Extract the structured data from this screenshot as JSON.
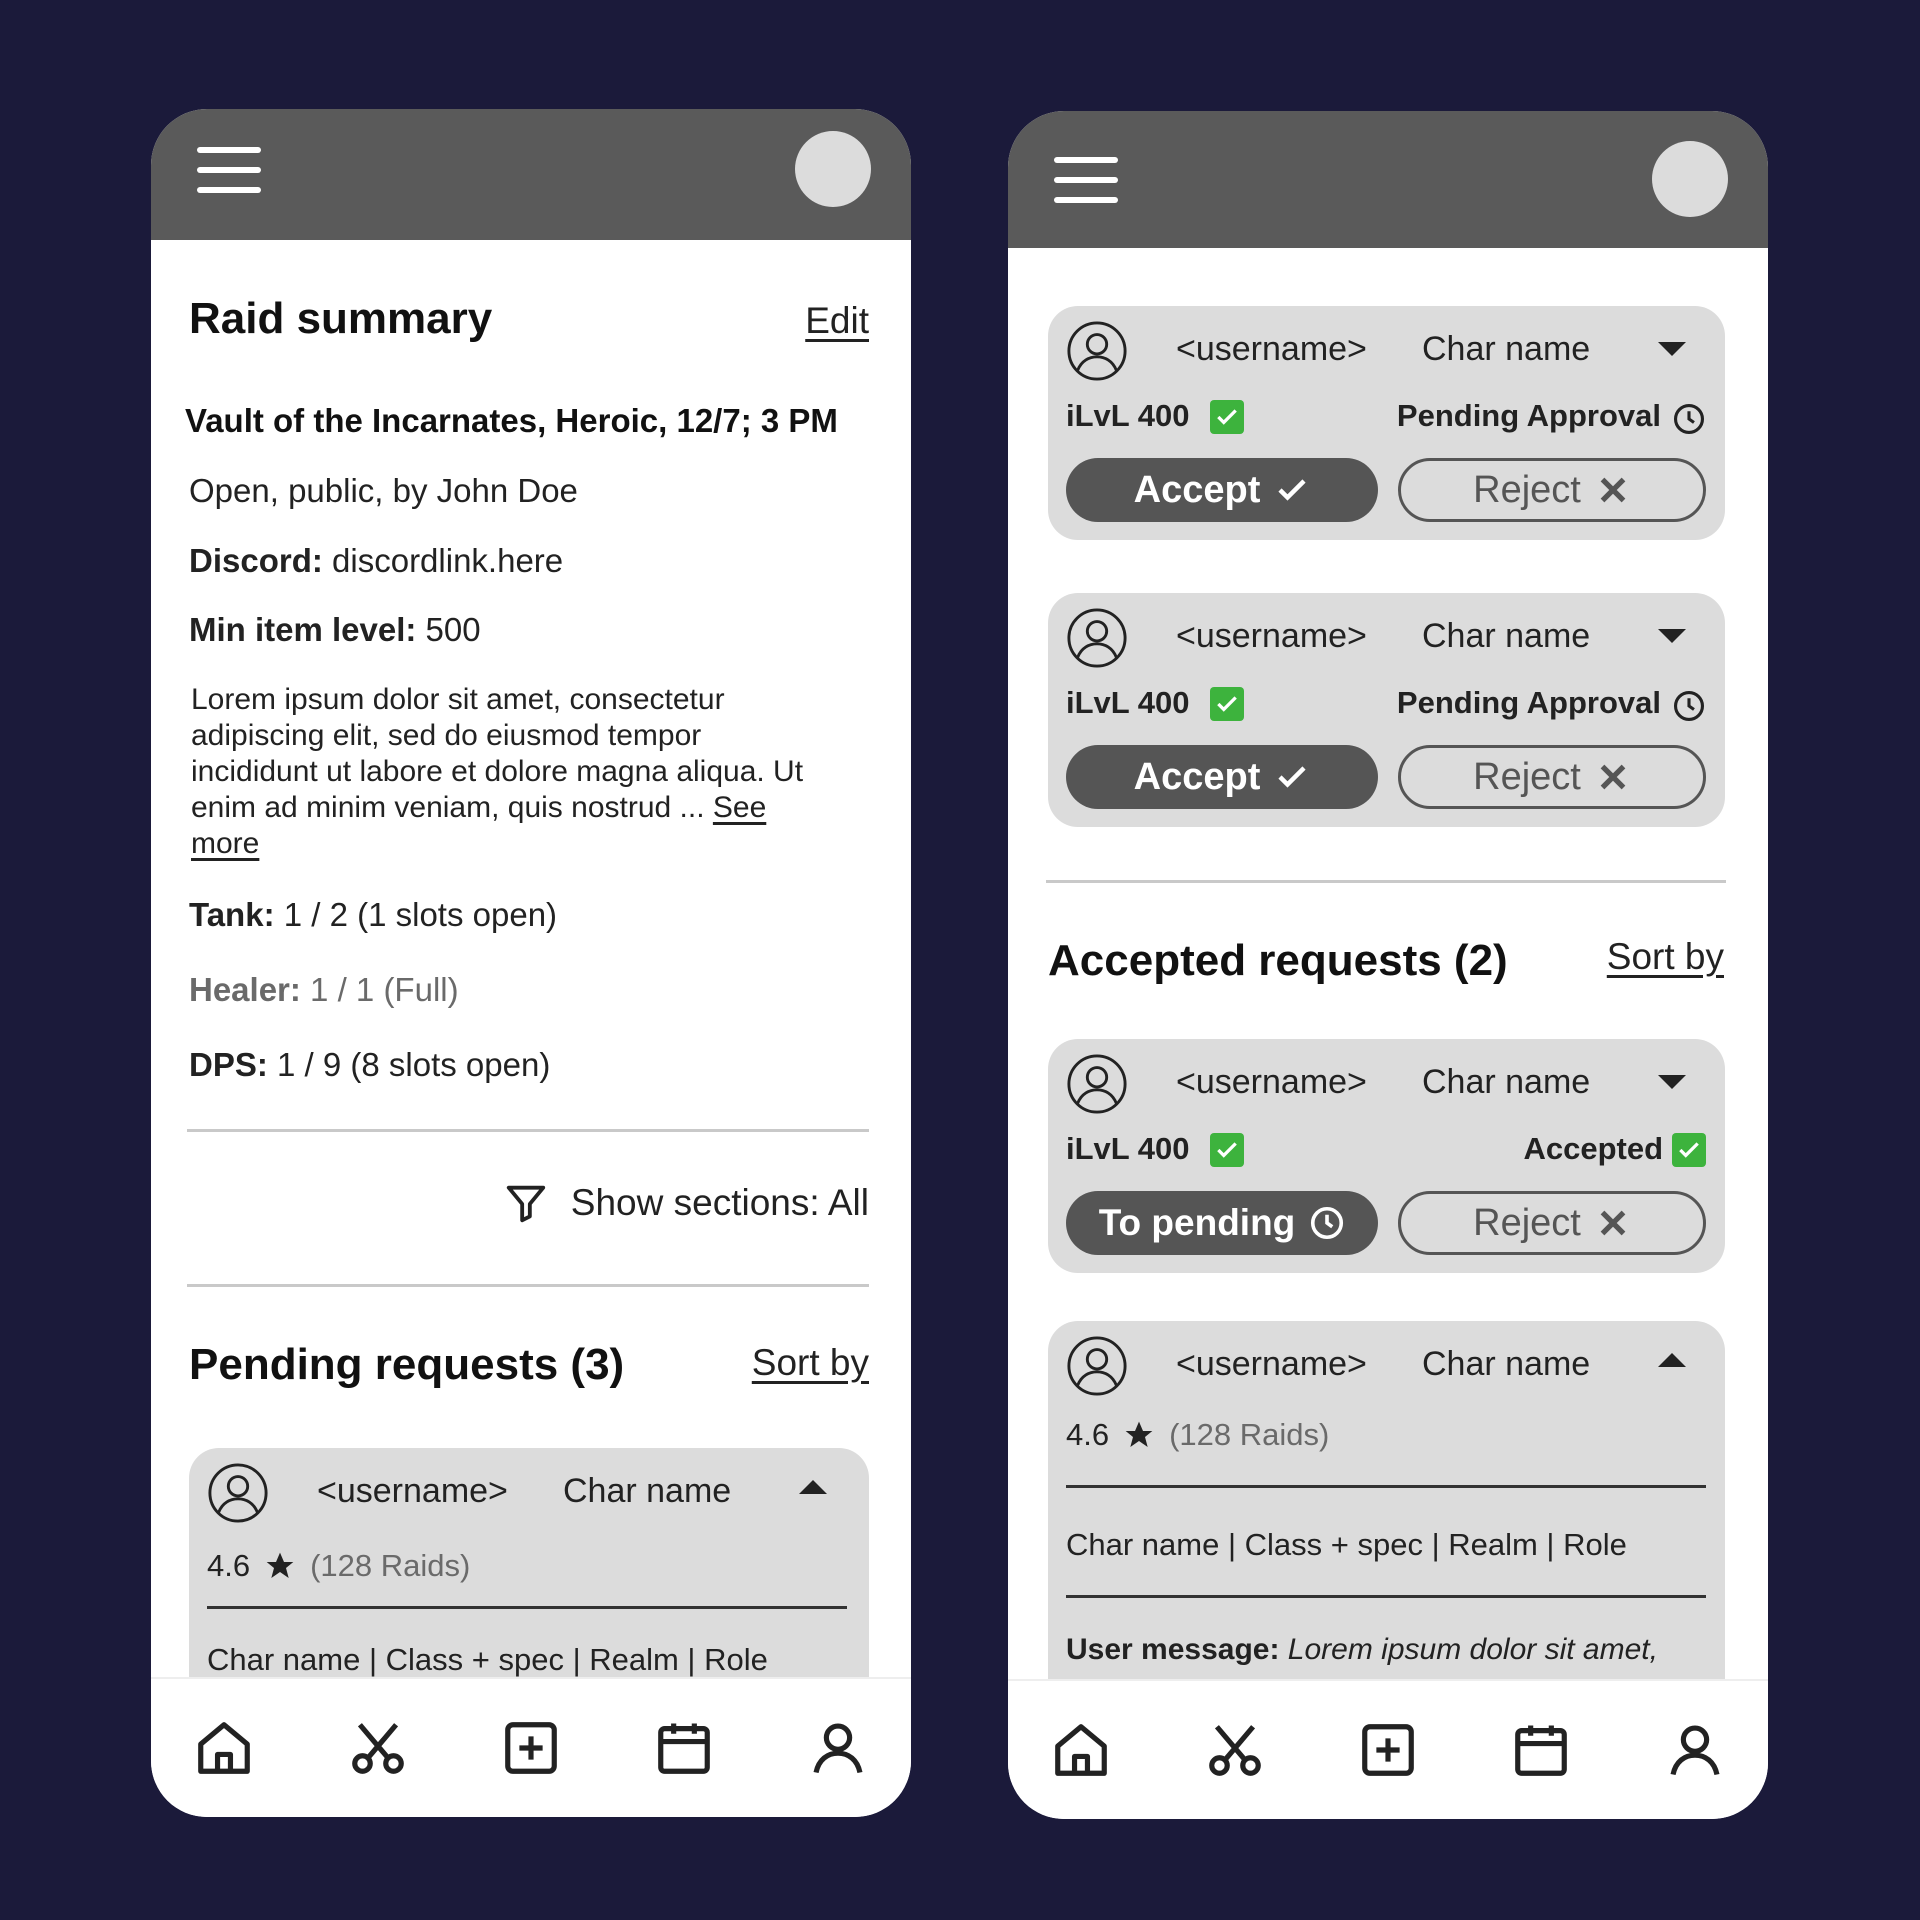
{
  "left": {
    "summary": {
      "title": "Raid summary",
      "edit": "Edit",
      "raid_name": "Vault of the Incarnates, Heroic, 12/7; 3 PM",
      "visibility": "Open, public, by John Doe",
      "discord_label": "Discord:",
      "discord_value": " discordlink.here",
      "min_ilvl_label": "Min item level:",
      "min_ilvl_value": " 500",
      "desc_line1": "Lorem ipsum dolor sit amet, consectetur",
      "desc_line2": "adipiscing elit, sed do eiusmod tempor",
      "desc_line3": "incididunt ut labore et dolore magna aliqua. Ut",
      "desc_line4": "enim ad minim veniam, quis nostrud ... ",
      "see": "See",
      "more": "more",
      "tank_label": "Tank:",
      "tank_value": " 1 / 2 (1 slots open)",
      "healer_label": "Healer:",
      "healer_value": " 1 / 1 (Full)",
      "dps_label": "DPS:",
      "dps_value": " 1 / 9 (8 slots open)"
    },
    "filter": "Show sections: All",
    "pending": {
      "title": "Pending requests (3)",
      "sort": "Sort by",
      "card": {
        "username": "<username>",
        "char": "Char name",
        "rating": "4.6",
        "raids": "(128 Raids)",
        "details": "Char name | Class + spec | Realm | Role"
      }
    }
  },
  "right": {
    "pending_cards": [
      {
        "username": "<username>",
        "char": "Char name",
        "ilvl": "iLvL 400",
        "status": "Pending Approval",
        "accept": "Accept",
        "reject": "Reject"
      },
      {
        "username": "<username>",
        "char": "Char name",
        "ilvl": "iLvL 400",
        "status": "Pending Approval",
        "accept": "Accept",
        "reject": "Reject"
      }
    ],
    "accepted": {
      "title": "Accepted requests (2)",
      "sort": "Sort by",
      "card1": {
        "username": "<username>",
        "char": "Char name",
        "ilvl": "iLvL 400",
        "status": "Accepted",
        "to_pending": "To pending",
        "reject": "Reject"
      },
      "card2": {
        "username": "<username>",
        "char": "Char name",
        "rating": "4.6",
        "raids": "(128 Raids)",
        "details": "Char name | Class + spec | Realm | Role",
        "msg_label": "User message:",
        "msg_value": " Lorem ipsum dolor sit amet,"
      }
    }
  },
  "nav_icons": [
    "home-icon",
    "scissors-icon",
    "add-square-icon",
    "calendar-icon",
    "profile-icon"
  ],
  "colors": {
    "background": "#1b1a3a",
    "topbar": "#5a5a5a",
    "card": "#dcdcdc",
    "check": "#3db33d",
    "button_dark": "#555555"
  }
}
